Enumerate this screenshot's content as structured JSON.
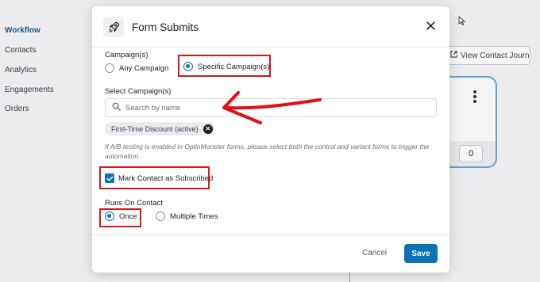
{
  "background": {
    "sidebar_items": [
      "Workflow",
      "Contacts",
      "Analytics",
      "Engagements",
      "Orders"
    ],
    "journey_button": "View Contact Journey",
    "card_count": "0"
  },
  "modal": {
    "title": "Form Submits",
    "icon": "rocket-icon",
    "campaigns": {
      "label": "Campaign(s)",
      "options": [
        "Any Campaign",
        "Specific Campaign(s)"
      ],
      "selected": "Specific Campaign(s)"
    },
    "select_campaigns": {
      "label": "Select Campaign(s)",
      "placeholder": "Search by name",
      "value": "",
      "selected_tags": [
        "First-Time Discount (active)"
      ]
    },
    "help_text": "If A/B testing is enabled in OptinMonster forms, please select both the control and variant forms to trigger the automation.",
    "mark_subscribed": {
      "label": "Mark Contact as Subscribed",
      "checked": true
    },
    "runs_on_contact": {
      "label": "Runs On Contact",
      "options": [
        "Once",
        "Multiple Times"
      ],
      "selected": "Once"
    },
    "footer": {
      "cancel_label": "Cancel",
      "save_label": "Save"
    }
  },
  "colors": {
    "accent": "#0a72b5",
    "highlight": "#d7151d",
    "tag_bg": "#e8ebf0"
  }
}
